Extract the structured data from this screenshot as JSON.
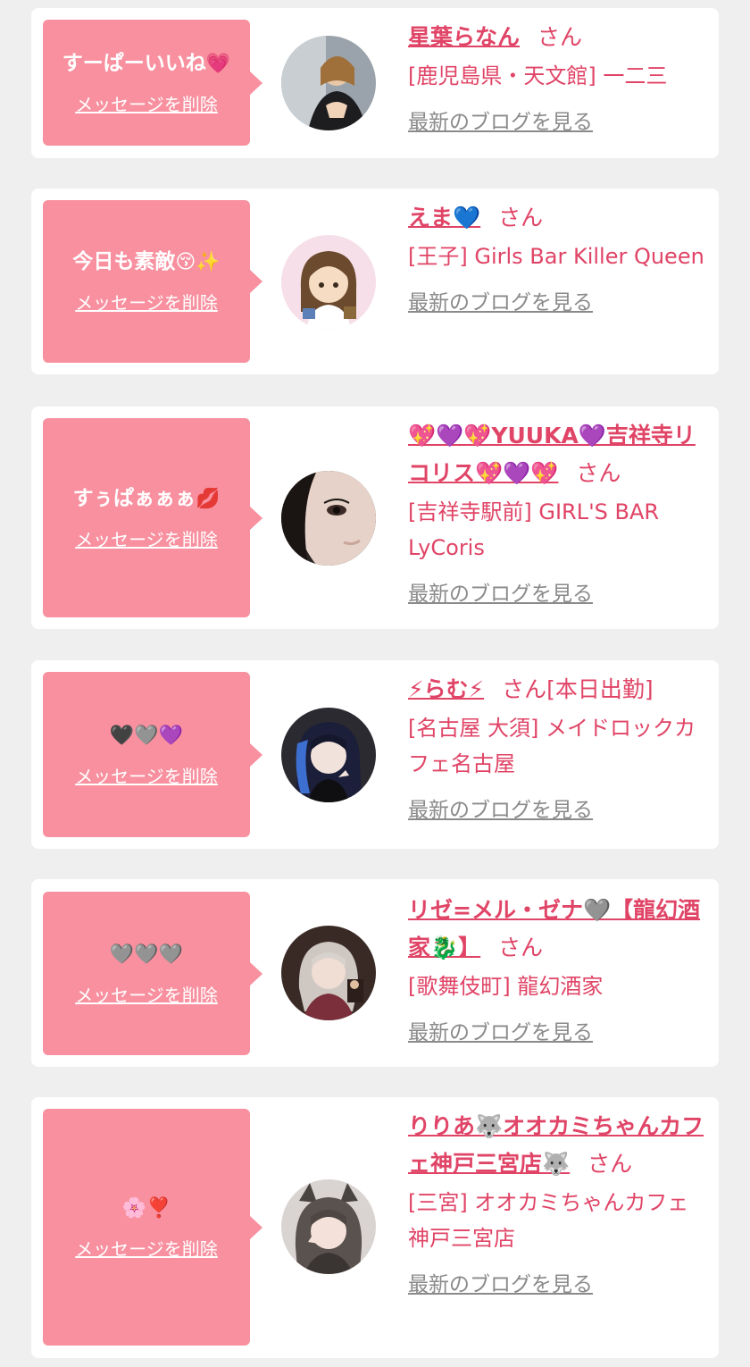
{
  "entries": [
    {
      "message": "すーぱーいいね",
      "message_emoji": "💗",
      "delete_label": "メッセージを削除",
      "name": "星葉らなん",
      "san": "さん",
      "status_badge": "",
      "shop": "[鹿児島県・天文館] 一二三",
      "blog_link": "最新のブログを見る",
      "avatar_icon": "avatar-photo-icon"
    },
    {
      "message": "今日も素敵",
      "message_emoji": "😚✨",
      "delete_label": "メッセージを削除",
      "name": "えま💙",
      "san": "さん",
      "status_badge": "",
      "shop": "[王子] Girls Bar Killer Queen",
      "blog_link": "最新のブログを見る",
      "avatar_icon": "avatar-illustration-icon"
    },
    {
      "message": "すぅぱぁぁぁ",
      "message_emoji": "💋",
      "delete_label": "メッセージを削除",
      "name": "💖💜💖YUUKA💜吉祥寺リコリス💖💜💖",
      "san": "さん",
      "status_badge": "",
      "shop": "[吉祥寺駅前] GIRL'S BAR LyCoris",
      "blog_link": "最新のブログを見る",
      "avatar_icon": "avatar-photo-icon"
    },
    {
      "message": "",
      "message_emoji": "🖤🩶💜",
      "delete_label": "メッセージを削除",
      "name": "⚡らむ⚡",
      "san": "さん",
      "status_badge": "[本日出勤]",
      "shop": "[名古屋 大須] メイドロックカフェ名古屋",
      "blog_link": "最新のブログを見る",
      "avatar_icon": "avatar-photo-icon"
    },
    {
      "message": "",
      "message_emoji": "🩶🩶🩶",
      "delete_label": "メッセージを削除",
      "name": "リゼ=メル・ゼナ🩶【龍幻酒家🐉】",
      "san": "さん",
      "status_badge": "",
      "shop": "[歌舞伎町] 龍幻酒家",
      "blog_link": "最新のブログを見る",
      "avatar_icon": "avatar-photo-icon"
    },
    {
      "message": "",
      "message_emoji": "🌸❣️",
      "delete_label": "メッセージを削除",
      "name": "りりあ🐺オオカミちゃんカフェ神戸三宮店🐺",
      "san": "さん",
      "status_badge": "",
      "shop": "[三宮] オオカミちゃんカフェ神戸三宮店",
      "blog_link": "最新のブログを見る",
      "avatar_icon": "avatar-photo-icon"
    }
  ],
  "colors": {
    "page_background": "#efefef",
    "card_background": "#ffffff",
    "bubble": "#f8909f",
    "accent_text": "#e04466",
    "muted_link": "#8a8a8a"
  }
}
